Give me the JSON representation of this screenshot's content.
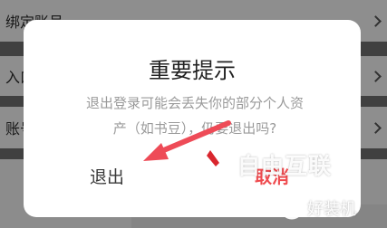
{
  "background": {
    "rows": [
      {
        "label": "绑定账号"
      },
      {
        "label": "入口"
      },
      {
        "label": "账号"
      }
    ]
  },
  "dialog": {
    "title": "重要提示",
    "message": "退出登录可能会丢失你的部分个人资产（如书豆），仍要退出吗?",
    "exit_label": "退出",
    "cancel_label": "取消"
  },
  "watermark": {
    "brand_text": "自由互联",
    "logo_text": "好装机"
  },
  "colors": {
    "accent_red": "#ef4b4f",
    "arrow_red": "#ee4b57"
  }
}
